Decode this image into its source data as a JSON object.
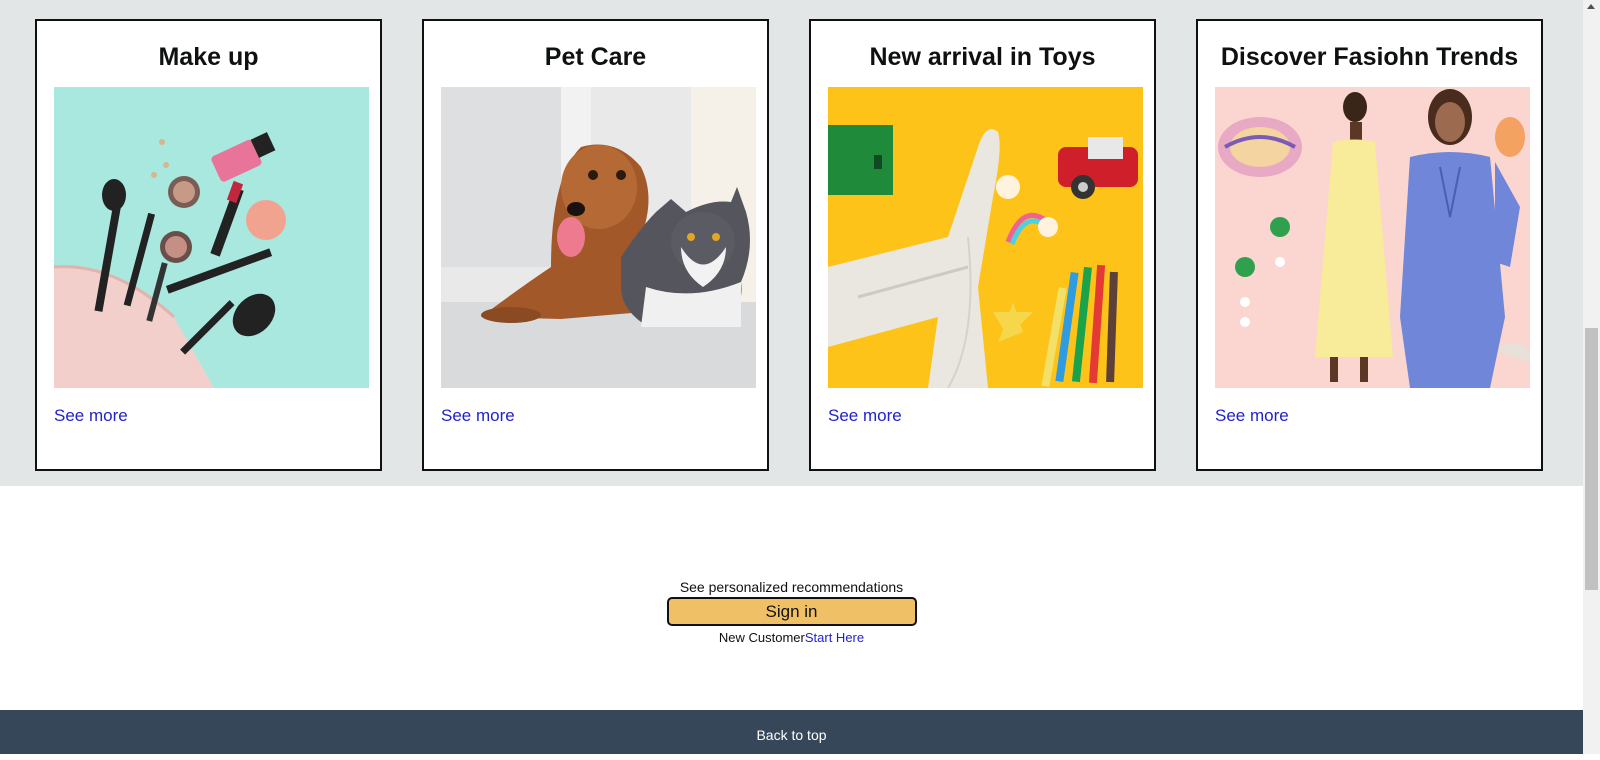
{
  "cards": [
    {
      "title": "Make up",
      "link": "See more",
      "image": "makeup-products-image"
    },
    {
      "title": "Pet Care",
      "link": "See more",
      "image": "dog-and-cat-image"
    },
    {
      "title": "New arrival in Toys",
      "link": "See more",
      "image": "toys-image"
    },
    {
      "title": "Discover Fasiohn Trends",
      "link": "See more",
      "image": "fashion-models-image"
    }
  ],
  "signin": {
    "prompt": "See personalized recommendations",
    "button_label": "Sign in",
    "new_customer_text": "New Customer",
    "start_here_link": "Start Here"
  },
  "footer": {
    "back_to_top": "Back to top"
  },
  "colors": {
    "band_bg": "#e3e6e6",
    "signin_button": "#f0c066",
    "link": "#2222cc",
    "footer_bg": "#37475a"
  }
}
